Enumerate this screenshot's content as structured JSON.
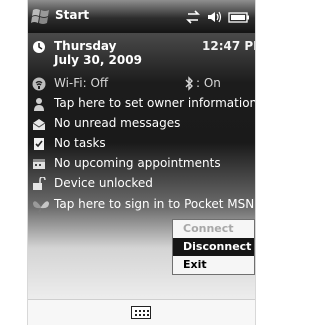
{
  "titlebar": {
    "title": "Start"
  },
  "today": {
    "day": "Thursday",
    "date": "July 30, 2009",
    "time": "12:47 PM",
    "wifi": "Wi-Fi: Off",
    "bluetooth": ": On",
    "owner": "Tap here to set owner information",
    "messages": "No unread messages",
    "tasks": "No tasks",
    "appointments": "No upcoming appointments",
    "device": "Device unlocked",
    "msn": "Tap here to sign in to Pocket MSN!"
  },
  "menu": {
    "connect": "Connect",
    "disconnect": "Disconnect",
    "exit": "Exit"
  },
  "colors": {
    "menu_selected_bg": "#151515",
    "menu_disabled": "#a8a8a8"
  }
}
